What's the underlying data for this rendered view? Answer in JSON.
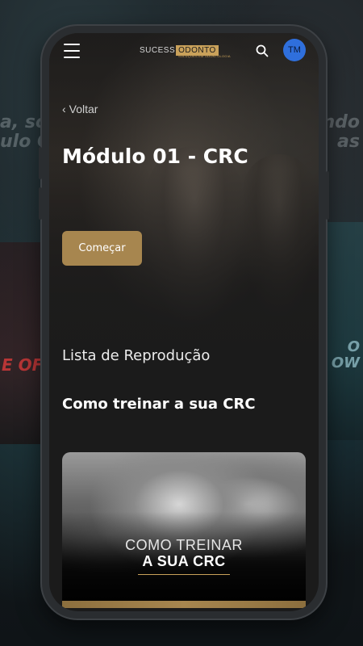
{
  "background": {
    "left_text": [
      "a, sou",
      "ulo Co"
    ],
    "right_text": [
      "ando",
      "as"
    ],
    "left_card_text": "E OF",
    "right_card_text": [
      "O",
      "OW"
    ]
  },
  "header": {
    "logo_part1": "SUCESS",
    "logo_part2": "ODONTO",
    "logo_subtitle": "SOLUÇÕES EM ODONTOLOGIA",
    "avatar_initials": "TM",
    "avatar_color": "#2f6fdc"
  },
  "nav": {
    "back_label": "Voltar"
  },
  "module": {
    "title": "Módulo 01 - CRC",
    "start_button": "Começar",
    "accent_color": "#a7864f"
  },
  "playlist": {
    "heading": "Lista de Reprodução",
    "lesson_title": "Como treinar a sua CRC",
    "thumbnail_line1": "COMO TREINAR",
    "thumbnail_line2": "A SUA CRC"
  },
  "icons": {
    "menu": "hamburger-menu-icon",
    "search": "search-icon",
    "back": "chevron-left-icon"
  }
}
